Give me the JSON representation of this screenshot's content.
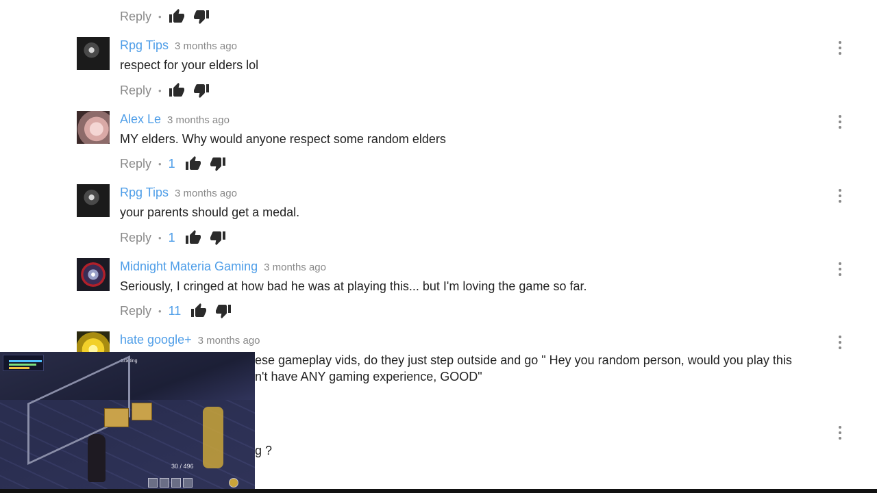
{
  "top_actions": {
    "reply": "Reply",
    "sep": "•"
  },
  "comments": [
    {
      "author": "Rpg Tips",
      "time": "3 months ago",
      "text": "respect for your elders lol",
      "reply": "Reply",
      "sep": "•",
      "likes": ""
    },
    {
      "author": "Alex Le",
      "time": "3 months ago",
      "text": "MY elders. Why would anyone respect some random elders",
      "reply": "Reply",
      "sep": "•",
      "likes": "1"
    },
    {
      "author": "Rpg Tips",
      "time": "3 months ago",
      "text": "your parents should get a medal.",
      "reply": "Reply",
      "sep": "•",
      "likes": "1"
    },
    {
      "author": "Midnight Materia Gaming",
      "time": "3 months ago",
      "text": "Seriously, I cringed at how bad he was at playing this... but I'm loving the game so far.",
      "reply": "Reply",
      "sep": "•",
      "likes": "11"
    },
    {
      "author": "hate google+",
      "time": "3 months ago",
      "text_line1": "ese gameplay vids, do they just step outside and go \" Hey you random person, would you play this",
      "text_line2": "n't have ANY gaming experience, GOOD\""
    }
  ],
  "partial_comment": {
    "text": "g ?"
  },
  "video_overlay": {
    "title": "Crafting",
    "ammo": "30 / 496"
  },
  "icons": {
    "like": "thumbs-up-icon",
    "dislike": "thumbs-down-icon",
    "menu": "kebab-menu-icon"
  },
  "colors": {
    "author": "#4f9ee8",
    "likes": "#4f9ee8",
    "meta": "#888888"
  }
}
